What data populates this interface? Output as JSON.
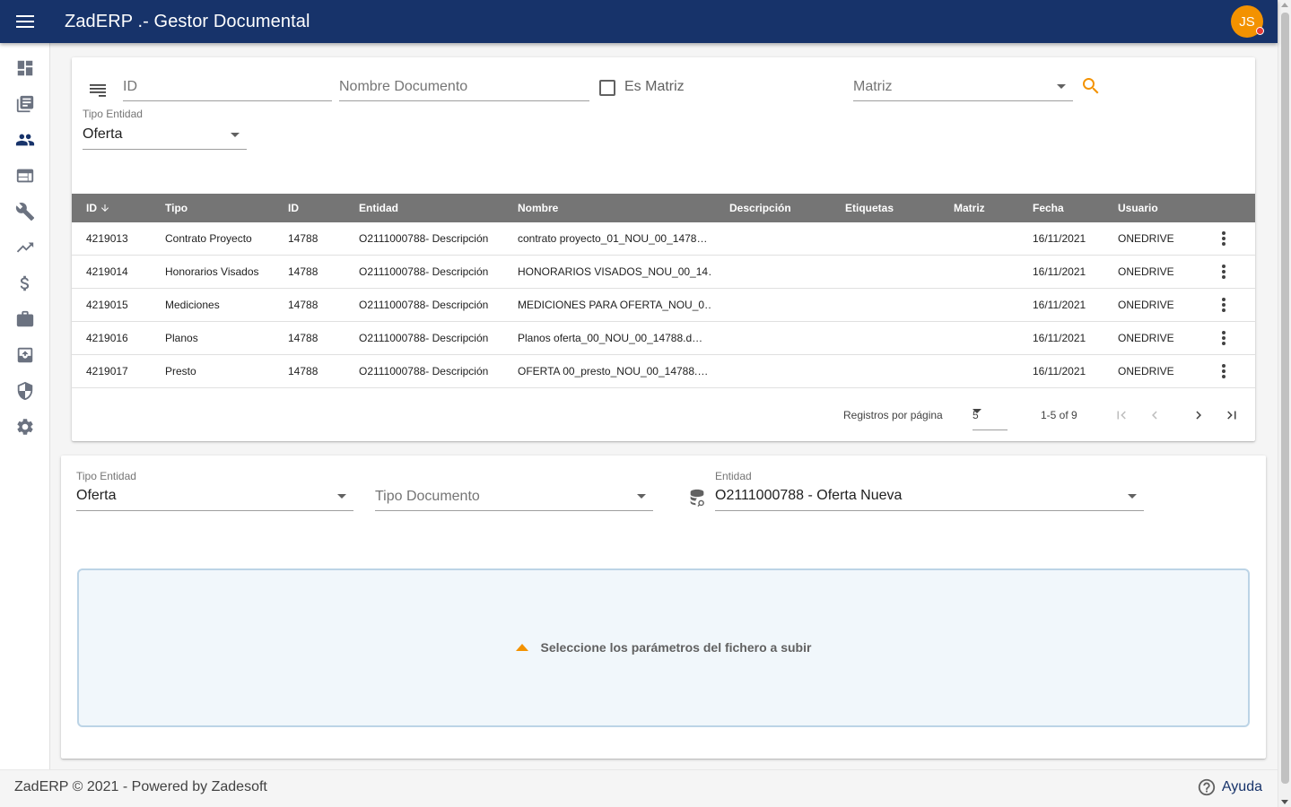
{
  "app": {
    "title": "ZadERP .- Gestor Documental",
    "user_initials": "JS"
  },
  "sidebar": {
    "items": [
      {
        "name": "dashboard-icon"
      },
      {
        "name": "library-books-icon"
      },
      {
        "name": "people-icon"
      },
      {
        "name": "web-window-icon"
      },
      {
        "name": "wrench-icon"
      },
      {
        "name": "trending-up-icon"
      },
      {
        "name": "dollar-icon"
      },
      {
        "name": "briefcase-icon"
      },
      {
        "name": "archive-upload-icon"
      },
      {
        "name": "shield-icon"
      },
      {
        "name": "gear-icon"
      }
    ]
  },
  "filters": {
    "id_placeholder": "ID",
    "nombre_placeholder": "Nombre Documento",
    "es_matriz_label": "Es Matriz",
    "matriz_placeholder": "Matriz",
    "tipo_entidad_label": "Tipo Entidad",
    "tipo_entidad_value": "Oferta"
  },
  "table": {
    "columns": [
      "ID",
      "Tipo",
      "ID",
      "Entidad",
      "Nombre",
      "Descripción",
      "Etiquetas",
      "Matriz",
      "Fecha",
      "Usuario"
    ],
    "rows": [
      {
        "id": "4219013",
        "tipo": "Contrato Proyecto",
        "id2": "14788",
        "entidad": "O2111000788- Descripción",
        "nombre": "contrato proyecto_01_NOU_00_1478…",
        "descripcion": "",
        "etiquetas": "",
        "matriz": "",
        "fecha": "16/11/2021",
        "usuario": "ONEDRIVE"
      },
      {
        "id": "4219014",
        "tipo": "Honorarios Visados",
        "id2": "14788",
        "entidad": "O2111000788- Descripción",
        "nombre": "HONORARIOS VISADOS_NOU_00_14…",
        "descripcion": "",
        "etiquetas": "",
        "matriz": "",
        "fecha": "16/11/2021",
        "usuario": "ONEDRIVE"
      },
      {
        "id": "4219015",
        "tipo": "Mediciones",
        "id2": "14788",
        "entidad": "O2111000788- Descripción",
        "nombre": "MEDICIONES PARA OFERTA_NOU_0…",
        "descripcion": "",
        "etiquetas": "",
        "matriz": "",
        "fecha": "16/11/2021",
        "usuario": "ONEDRIVE"
      },
      {
        "id": "4219016",
        "tipo": "Planos",
        "id2": "14788",
        "entidad": "O2111000788- Descripción",
        "nombre": "Planos oferta_00_NOU_00_14788.d…",
        "descripcion": "",
        "etiquetas": "",
        "matriz": "",
        "fecha": "16/11/2021",
        "usuario": "ONEDRIVE"
      },
      {
        "id": "4219017",
        "tipo": "Presto",
        "id2": "14788",
        "entidad": "O2111000788- Descripción",
        "nombre": "OFERTA 00_presto_NOU_00_14788.…",
        "descripcion": "",
        "etiquetas": "",
        "matriz": "",
        "fecha": "16/11/2021",
        "usuario": "ONEDRIVE"
      }
    ],
    "paginator": {
      "label": "Registros por página",
      "page_size": "5",
      "range": "1-5 of 9"
    }
  },
  "upload": {
    "tipo_entidad_label": "Tipo Entidad",
    "tipo_entidad_value": "Oferta",
    "tipo_documento_placeholder": "Tipo Documento",
    "entidad_label": "Entidad",
    "entidad_value": "O2111000788 - Oferta Nueva",
    "dropzone_message": "Seleccione los parámetros del fichero a subir"
  },
  "footer": {
    "copyright": "ZadERP © 2021 - Powered by Zadesoft",
    "help": "Ayuda"
  },
  "colors": {
    "primary": "#17336a",
    "accent": "#f39200",
    "header_row": "#757575"
  }
}
